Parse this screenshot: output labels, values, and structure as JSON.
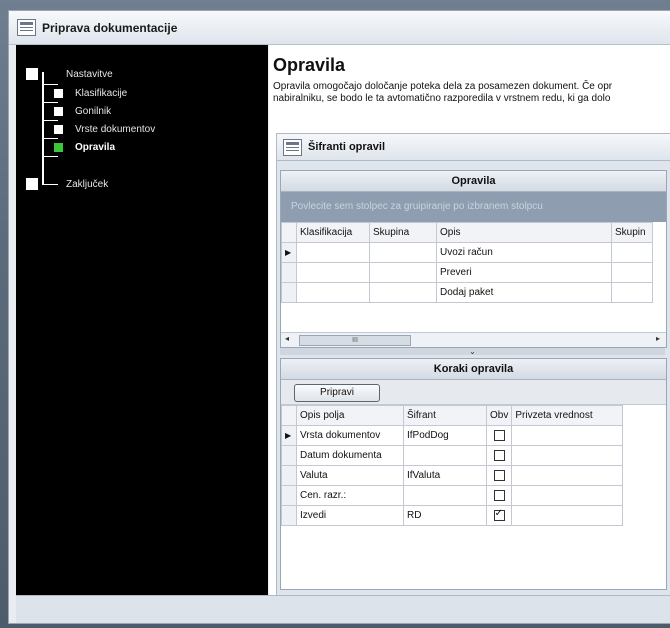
{
  "window": {
    "title": "Priprava dokumentacije"
  },
  "tree": {
    "items": [
      {
        "label": "Nastavitve",
        "active": false,
        "bold": false
      },
      {
        "label": "Klasifikacije",
        "active": false,
        "bold": false
      },
      {
        "label": "Gonilnik",
        "active": false,
        "bold": false
      },
      {
        "label": "Vrste dokumentov",
        "active": false,
        "bold": false
      },
      {
        "label": "Opravila",
        "active": true,
        "bold": true
      },
      {
        "label": "Zaključek",
        "active": false,
        "bold": false
      }
    ]
  },
  "main": {
    "title": "Opravila",
    "description_line1": "Opravila omogočajo določanje poteka dela za posamezen dokument. Če opr",
    "description_line2": "nabiralniku, se bodo le ta avtomatično razporedila v vrstnem redu, ki ga dolo"
  },
  "panel": {
    "title": "Šifranti opravil"
  },
  "opravila_grid": {
    "band_title": "Opravila",
    "group_hint": "Povlecite sem stolpec za gruipiranje po izbranem stolpcu",
    "columns": [
      "Klasifikacija",
      "Skupina",
      "Opis",
      "Skupin"
    ],
    "rows": [
      {
        "klasifikacija": "",
        "skupina": "",
        "opis": "Uvozi račun",
        "skupin": ""
      },
      {
        "klasifikacija": "",
        "skupina": "",
        "opis": "Preveri",
        "skupin": ""
      },
      {
        "klasifikacija": "",
        "skupina": "",
        "opis": "Dodaj paket",
        "skupin": ""
      }
    ],
    "scroll_thumb_text": "III"
  },
  "koraki_grid": {
    "band_title": "Koraki opravila",
    "button_label": "Pripravi",
    "columns": [
      "Opis polja",
      "Šifrant",
      "Obv",
      "Privzeta vrednost"
    ],
    "rows": [
      {
        "opis": "Vrsta dokumentov",
        "sifrant": "IfPodDog",
        "obv": false,
        "privzeta": ""
      },
      {
        "opis": "Datum dokumenta",
        "sifrant": "",
        "obv": false,
        "privzeta": ""
      },
      {
        "opis": "Valuta",
        "sifrant": "IfValuta",
        "obv": false,
        "privzeta": ""
      },
      {
        "opis": "Cen. razr.:",
        "sifrant": "",
        "obv": false,
        "privzeta": ""
      },
      {
        "opis": "Izvedi",
        "sifrant": "RD",
        "obv": true,
        "privzeta": ""
      }
    ]
  },
  "colors": {
    "tree_background": "#000000",
    "active_node": "#39c839",
    "group_area": "#8e9eb0"
  }
}
